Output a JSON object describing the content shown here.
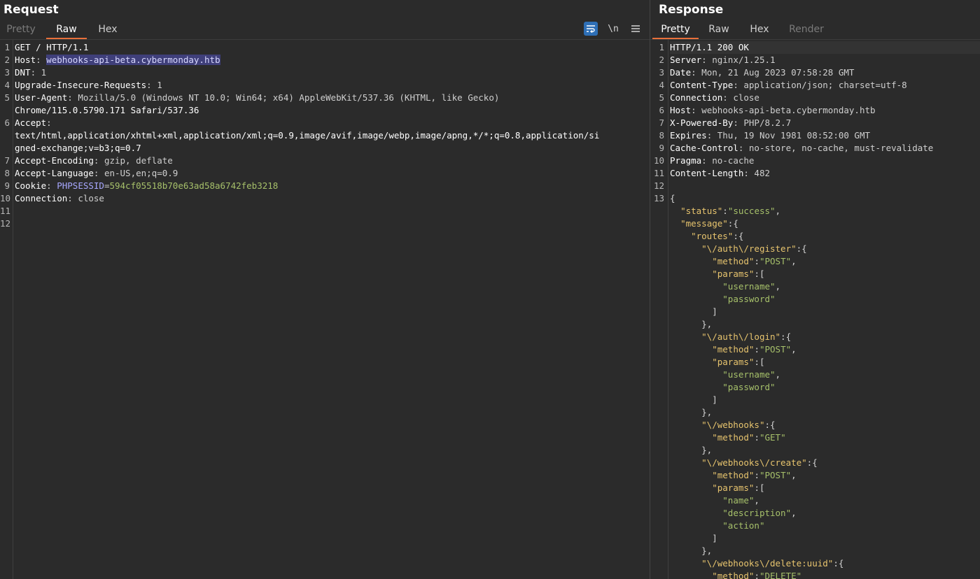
{
  "request": {
    "title": "Request",
    "tabs": [
      "Pretty",
      "Raw",
      "Hex"
    ],
    "active_tab": "Raw",
    "toolbar": {
      "wrap_icon": "word-wrap-icon",
      "newline_label": "\\n",
      "menu_icon": "hamburger-menu-icon"
    },
    "lines": [
      {
        "n": "1",
        "text": "GET / HTTP/1.1"
      },
      {
        "n": "2",
        "key": "Host",
        "value": "webhooks-api-beta.cybermonday.htb"
      },
      {
        "n": "3",
        "key": "DNT",
        "value": "1"
      },
      {
        "n": "4",
        "key": "Upgrade-Insecure-Requests",
        "value": "1"
      },
      {
        "n": "5",
        "key": "User-Agent",
        "value": "Mozilla/5.0 (Windows NT 10.0; Win64; x64) AppleWebKit/537.36 (KHTML, like Gecko)"
      },
      {
        "n": "",
        "text": "Chrome/115.0.5790.171 Safari/537.36"
      },
      {
        "n": "6",
        "key": "Accept",
        "value": ""
      },
      {
        "n": "",
        "text": "text/html,application/xhtml+xml,application/xml;q=0.9,image/avif,image/webp,image/apng,*/*;q=0.8,application/si"
      },
      {
        "n": "",
        "text": "gned-exchange;v=b3;q=0.7"
      },
      {
        "n": "7",
        "key": "Accept-Encoding",
        "value": "gzip, deflate"
      },
      {
        "n": "8",
        "key": "Accept-Language",
        "value": "en-US,en;q=0.9"
      },
      {
        "n": "9",
        "key": "Cookie",
        "cookie_name": "PHPSESSID",
        "cookie_value": "594cf05518b70e63ad58a6742feb3218"
      },
      {
        "n": "10",
        "key": "Connection",
        "value": "close"
      },
      {
        "n": "11",
        "text": ""
      },
      {
        "n": "12",
        "text": ""
      }
    ]
  },
  "response": {
    "title": "Response",
    "tabs": [
      "Pretty",
      "Raw",
      "Hex",
      "Render"
    ],
    "active_tab": "Pretty",
    "headers": [
      {
        "n": "1",
        "text": "HTTP/1.1 200 OK"
      },
      {
        "n": "2",
        "key": "Server",
        "value": "nginx/1.25.1"
      },
      {
        "n": "3",
        "key": "Date",
        "value": "Mon, 21 Aug 2023 07:58:28 GMT"
      },
      {
        "n": "4",
        "key": "Content-Type",
        "value": "application/json; charset=utf-8"
      },
      {
        "n": "5",
        "key": "Connection",
        "value": "close"
      },
      {
        "n": "6",
        "key": "Host",
        "value": "webhooks-api-beta.cybermonday.htb"
      },
      {
        "n": "7",
        "key": "X-Powered-By",
        "value": "PHP/8.2.7"
      },
      {
        "n": "8",
        "key": "Expires",
        "value": "Thu, 19 Nov 1981 08:52:00 GMT"
      },
      {
        "n": "9",
        "key": "Cache-Control",
        "value": "no-store, no-cache, must-revalidate"
      },
      {
        "n": "10",
        "key": "Pragma",
        "value": "no-cache"
      },
      {
        "n": "11",
        "key": "Content-Length",
        "value": "482"
      },
      {
        "n": "12",
        "text": ""
      }
    ],
    "json_lines": [
      {
        "n": "13",
        "indent": 0,
        "parts": [
          [
            "p",
            "{"
          ]
        ]
      },
      {
        "indent": 1,
        "parts": [
          [
            "k",
            "\"status\""
          ],
          [
            "p",
            ":"
          ],
          [
            "s",
            "\"success\""
          ],
          [
            "p",
            ","
          ]
        ]
      },
      {
        "indent": 1,
        "parts": [
          [
            "k",
            "\"message\""
          ],
          [
            "p",
            ":{"
          ]
        ]
      },
      {
        "indent": 2,
        "parts": [
          [
            "k",
            "\"routes\""
          ],
          [
            "p",
            ":{"
          ]
        ]
      },
      {
        "indent": 3,
        "parts": [
          [
            "k",
            "\"\\/auth\\/register\""
          ],
          [
            "p",
            ":{"
          ]
        ]
      },
      {
        "indent": 4,
        "parts": [
          [
            "k",
            "\"method\""
          ],
          [
            "p",
            ":"
          ],
          [
            "s",
            "\"POST\""
          ],
          [
            "p",
            ","
          ]
        ]
      },
      {
        "indent": 4,
        "parts": [
          [
            "k",
            "\"params\""
          ],
          [
            "p",
            ":["
          ]
        ]
      },
      {
        "indent": 5,
        "parts": [
          [
            "s",
            "\"username\""
          ],
          [
            "p",
            ","
          ]
        ]
      },
      {
        "indent": 5,
        "parts": [
          [
            "s",
            "\"password\""
          ]
        ]
      },
      {
        "indent": 4,
        "parts": [
          [
            "p",
            "]"
          ]
        ]
      },
      {
        "indent": 3,
        "parts": [
          [
            "p",
            "},"
          ]
        ]
      },
      {
        "indent": 3,
        "parts": [
          [
            "k",
            "\"\\/auth\\/login\""
          ],
          [
            "p",
            ":{"
          ]
        ]
      },
      {
        "indent": 4,
        "parts": [
          [
            "k",
            "\"method\""
          ],
          [
            "p",
            ":"
          ],
          [
            "s",
            "\"POST\""
          ],
          [
            "p",
            ","
          ]
        ]
      },
      {
        "indent": 4,
        "parts": [
          [
            "k",
            "\"params\""
          ],
          [
            "p",
            ":["
          ]
        ]
      },
      {
        "indent": 5,
        "parts": [
          [
            "s",
            "\"username\""
          ],
          [
            "p",
            ","
          ]
        ]
      },
      {
        "indent": 5,
        "parts": [
          [
            "s",
            "\"password\""
          ]
        ]
      },
      {
        "indent": 4,
        "parts": [
          [
            "p",
            "]"
          ]
        ]
      },
      {
        "indent": 3,
        "parts": [
          [
            "p",
            "},"
          ]
        ]
      },
      {
        "indent": 3,
        "parts": [
          [
            "k",
            "\"\\/webhooks\""
          ],
          [
            "p",
            ":{"
          ]
        ]
      },
      {
        "indent": 4,
        "parts": [
          [
            "k",
            "\"method\""
          ],
          [
            "p",
            ":"
          ],
          [
            "s",
            "\"GET\""
          ]
        ]
      },
      {
        "indent": 3,
        "parts": [
          [
            "p",
            "},"
          ]
        ]
      },
      {
        "indent": 3,
        "parts": [
          [
            "k",
            "\"\\/webhooks\\/create\""
          ],
          [
            "p",
            ":{"
          ]
        ]
      },
      {
        "indent": 4,
        "parts": [
          [
            "k",
            "\"method\""
          ],
          [
            "p",
            ":"
          ],
          [
            "s",
            "\"POST\""
          ],
          [
            "p",
            ","
          ]
        ]
      },
      {
        "indent": 4,
        "parts": [
          [
            "k",
            "\"params\""
          ],
          [
            "p",
            ":["
          ]
        ]
      },
      {
        "indent": 5,
        "parts": [
          [
            "s",
            "\"name\""
          ],
          [
            "p",
            ","
          ]
        ]
      },
      {
        "indent": 5,
        "parts": [
          [
            "s",
            "\"description\""
          ],
          [
            "p",
            ","
          ]
        ]
      },
      {
        "indent": 5,
        "parts": [
          [
            "s",
            "\"action\""
          ]
        ]
      },
      {
        "indent": 4,
        "parts": [
          [
            "p",
            "]"
          ]
        ]
      },
      {
        "indent": 3,
        "parts": [
          [
            "p",
            "},"
          ]
        ]
      },
      {
        "indent": 3,
        "parts": [
          [
            "k",
            "\"\\/webhooks\\/delete:uuid\""
          ],
          [
            "p",
            ":{"
          ]
        ]
      },
      {
        "indent": 4,
        "parts": [
          [
            "k",
            "\"method\""
          ],
          [
            "p",
            ":"
          ],
          [
            "s",
            "\"DELETE\""
          ]
        ]
      }
    ]
  },
  "colors": {
    "accent_tab": "#e8703a",
    "selection": "#3f3f7a",
    "json_key": "#e7c46e",
    "json_string": "#a6c06a",
    "wrap_button": "#2e6fb6"
  }
}
